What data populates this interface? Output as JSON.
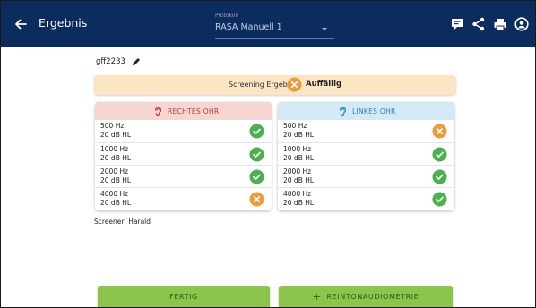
{
  "appbar": {
    "title": "Ergebnis",
    "protocol_label": "Protokoll",
    "protocol_value": "RASA Manuell 1"
  },
  "card_id": "gff2233",
  "screening": {
    "label": "Screening Ergebnis:",
    "result": "Auffällig"
  },
  "right_ear": {
    "title": "RECHTES OHR",
    "rows": [
      {
        "freq": "500 Hz",
        "level": "20 dB HL",
        "status": "pass"
      },
      {
        "freq": "1000 Hz",
        "level": "20 dB HL",
        "status": "pass"
      },
      {
        "freq": "2000 Hz",
        "level": "20 dB HL",
        "status": "pass"
      },
      {
        "freq": "4000 Hz",
        "level": "20 dB HL",
        "status": "fail"
      }
    ]
  },
  "left_ear": {
    "title": "LINKES OHR",
    "rows": [
      {
        "freq": "500 Hz",
        "level": "20 dB HL",
        "status": "fail"
      },
      {
        "freq": "1000 Hz",
        "level": "20 dB HL",
        "status": "pass"
      },
      {
        "freq": "2000 Hz",
        "level": "20 dB HL",
        "status": "pass"
      },
      {
        "freq": "4000 Hz",
        "level": "20 dB HL",
        "status": "pass"
      }
    ]
  },
  "screener": "Screener: Harald",
  "buttons": {
    "done": "FERTIG",
    "audiometry": "REINTONAUDIOMETRIE"
  },
  "colors": {
    "appbar": "#0d2c5e",
    "pass": "#4caf50",
    "fail": "#ef9a3d",
    "banner": "#fbe5c3",
    "right_head": "#f6d6d3",
    "left_head": "#d3e9f6",
    "button": "#8dc44c"
  },
  "icons": {
    "back": "arrow-left-icon",
    "notes": "notes-icon",
    "share": "share-icon",
    "print": "print-icon",
    "account": "account-icon",
    "edit": "pencil-icon",
    "right_ear": "ear-icon",
    "left_ear": "ear-icon",
    "pass": "check-circle-icon",
    "fail": "x-circle-icon"
  }
}
